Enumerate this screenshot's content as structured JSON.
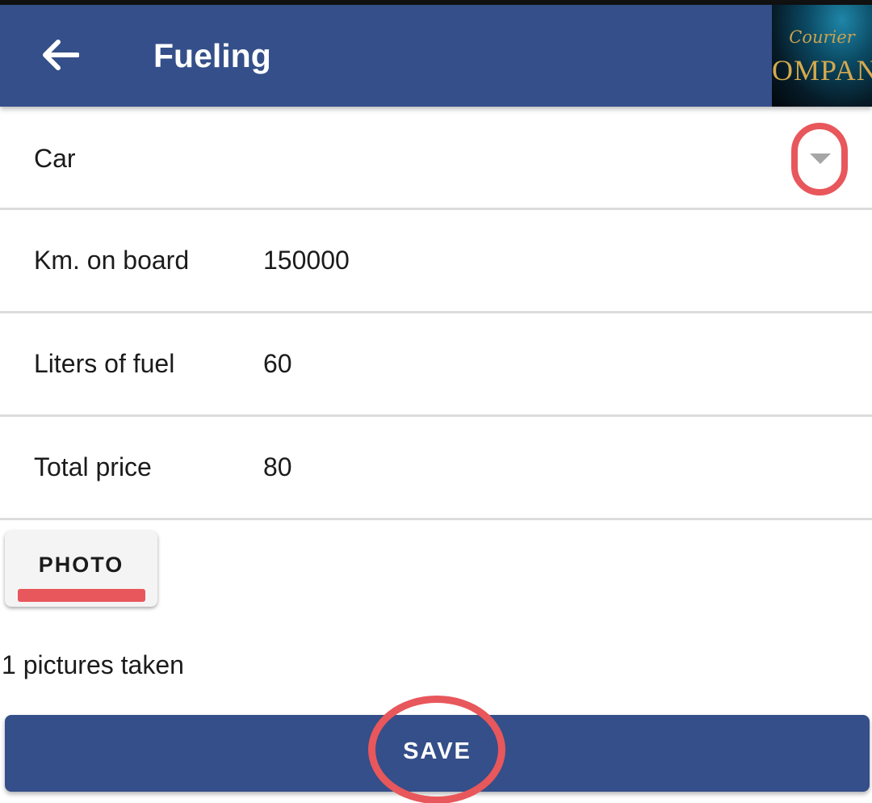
{
  "app_bar": {
    "title": "Fueling",
    "back_icon": "arrow-left-icon",
    "background": "#344f89"
  },
  "logo": {
    "script_text": "Courier",
    "word_text": "OMPAN"
  },
  "form": {
    "car": {
      "label": "Car",
      "dropdown_icon": "caret-down-icon"
    },
    "km": {
      "label": "Km. on board",
      "value": "150000"
    },
    "liters": {
      "label": "Liters of fuel",
      "value": "60"
    },
    "price": {
      "label": "Total price",
      "value": "80"
    }
  },
  "photo_button": {
    "label": "PHOTO"
  },
  "pictures_status": "1 pictures taken",
  "save_button": {
    "label": "SAVE"
  },
  "annotation_color": "#e8575b"
}
